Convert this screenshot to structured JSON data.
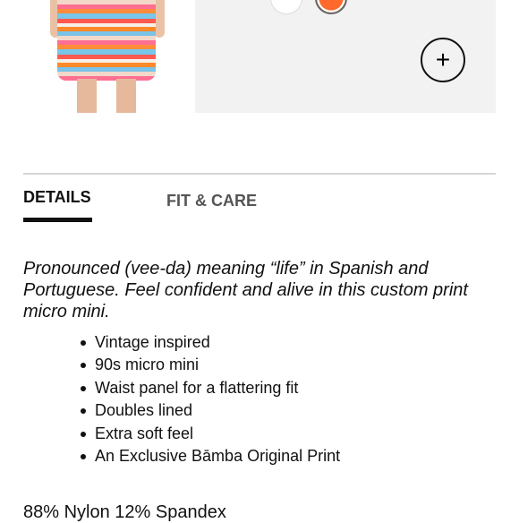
{
  "product": {
    "swatches": [
      {
        "name": "white",
        "color": "#ffffff"
      },
      {
        "name": "orange-stripe",
        "color": "#ff6a2c"
      }
    ],
    "zoom_icon": "plus-icon"
  },
  "tabs": {
    "details_label": "DETAILS",
    "fit_care_label": "FIT & CARE"
  },
  "details": {
    "description": "Pronounced (vee-da) meaning “life” in Spanish and Portuguese. Feel confident and alive in this custom print micro mini.",
    "features": [
      "Vintage inspired",
      "90s micro mini",
      "Waist panel for a flattering fit",
      "Doubles lined",
      "Extra soft feel",
      "An Exclusive Bāmba Original Print"
    ],
    "fabric": "88% Nylon 12% Spandex"
  }
}
